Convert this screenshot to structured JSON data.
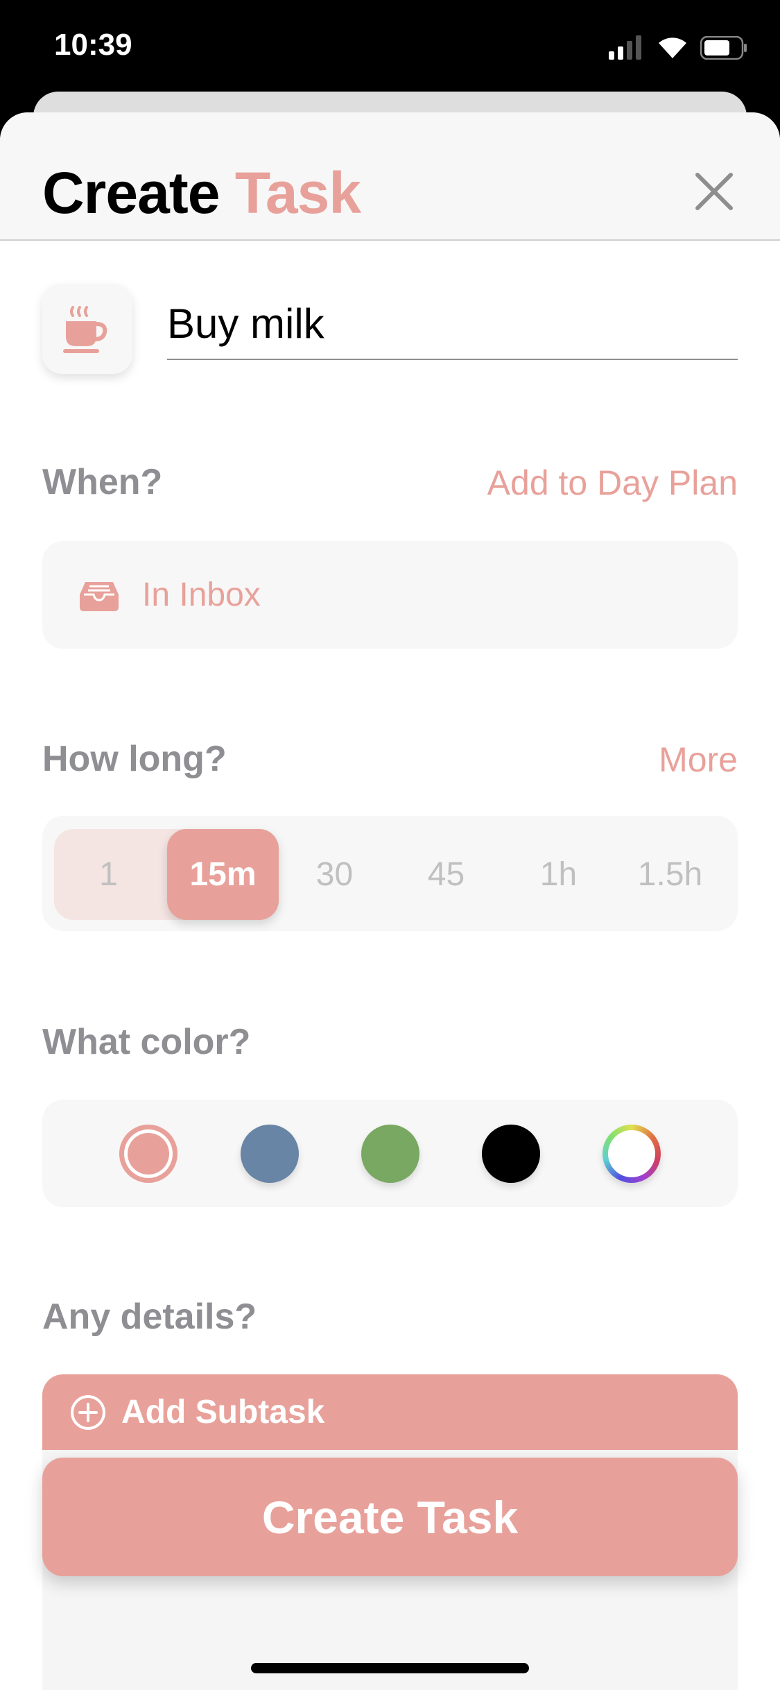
{
  "status_bar": {
    "time": "10:39",
    "icons": [
      "signal-icon",
      "wifi-icon",
      "battery-icon"
    ]
  },
  "header": {
    "title_prefix": "Create",
    "title_accent": "Task",
    "close_icon": "close-icon"
  },
  "task": {
    "icon": "coffee-cup-icon",
    "name": "Buy milk"
  },
  "when": {
    "label": "When?",
    "action": "Add to Day Plan",
    "value": "In Inbox",
    "icon": "inbox-tray-icon"
  },
  "duration": {
    "label": "How long?",
    "action": "More",
    "options": [
      "1",
      "15m",
      "30",
      "45",
      "1h",
      "1.5h"
    ],
    "selected": "15m"
  },
  "color": {
    "label": "What color?",
    "options": [
      "#e8a19a",
      "#6885a6",
      "#78a862",
      "#000000",
      "custom"
    ],
    "selected": "#e8a19a"
  },
  "details": {
    "label": "Any details?",
    "add_subtask": "Add Subtask"
  },
  "footer": {
    "create_button": "Create Task"
  },
  "colors": {
    "accent": "#e8a19a",
    "muted": "#8e8e93"
  }
}
